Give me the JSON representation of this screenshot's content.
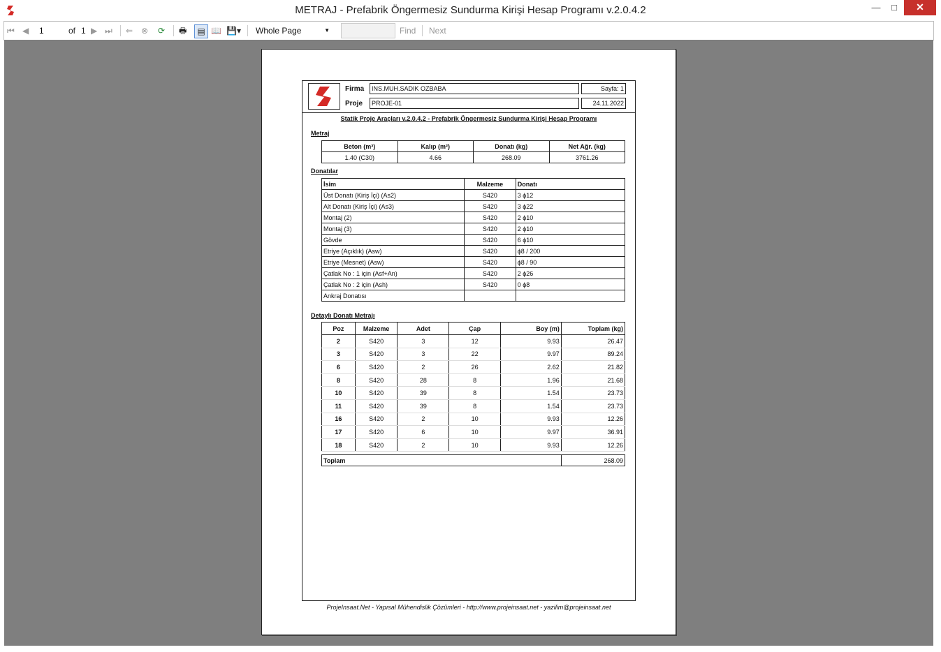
{
  "window": {
    "title": "METRAJ - Prefabrik Öngermesiz Sundurma Kirişi Hesap Programı v.2.0.4.2"
  },
  "toolbar": {
    "page_input": "1",
    "of_label": "of",
    "total_pages": "1",
    "zoom_selected": "Whole Page",
    "find_label": "Find",
    "next_label": "Next",
    "search_value": ""
  },
  "report": {
    "firma_label": "Firma",
    "firma_value": "INS.MUH.SADIK OZBABA",
    "proje_label": "Proje",
    "proje_value": "PROJE-01",
    "sayfa": "Sayfa: 1",
    "date": "24.11.2022",
    "subtitle": "Statik Proje Araçları v.2.0.4.2 - Prefabrik Öngermesiz Sundurma Kirişi Hesap Programı",
    "metraj_title": "Metraj",
    "metraj_headers": [
      "Beton (m³)",
      "Kalıp (m²)",
      "Donatı (kg)",
      "Net Ağr. (kg)"
    ],
    "metraj_values": [
      "1.40 (C30)",
      "4.66",
      "268.09",
      "3761.26"
    ],
    "donatilar_title": "Donatılar",
    "donatilar_headers": [
      "İsim",
      "Malzeme",
      "Donatı"
    ],
    "donatilar_rows": [
      [
        "Üst Donatı (Kiriş İçi) (As2)",
        "S420",
        "3 ϕ12"
      ],
      [
        "Alt Donatı (Kiriş İçi) (As3)",
        "S420",
        "3 ϕ22"
      ],
      [
        "Montaj (2)",
        "S420",
        "2 ϕ10"
      ],
      [
        "Montaj (3)",
        "S420",
        "2 ϕ10"
      ],
      [
        "Gövde",
        "S420",
        "6 ϕ10"
      ],
      [
        "Etriye (Açıklık) (Asw)",
        "S420",
        "ϕ8 / 200"
      ],
      [
        "Etriye (Mesnet) (Asw)",
        "S420",
        "ϕ8 / 90"
      ],
      [
        "Çatlak No : 1 için (Asf+An)",
        "S420",
        "2 ϕ26"
      ],
      [
        "Çatlak No : 2 için (Ash)",
        "S420",
        "0 ϕ8"
      ],
      [
        "Ankraj Donatısı",
        "",
        ""
      ]
    ],
    "detay_title": "Detaylı Donatı Metrajı",
    "detay_headers": [
      "Poz",
      "Malzeme",
      "Adet",
      "Çap",
      "Boy (m)",
      "Toplam (kg)"
    ],
    "detay_rows": [
      [
        "2",
        "S420",
        "3",
        "12",
        "9.93",
        "26.47"
      ],
      [
        "3",
        "S420",
        "3",
        "22",
        "9.97",
        "89.24"
      ],
      [
        "6",
        "S420",
        "2",
        "26",
        "2.62",
        "21.82"
      ],
      [
        "8",
        "S420",
        "28",
        "8",
        "1.96",
        "21.68"
      ],
      [
        "10",
        "S420",
        "39",
        "8",
        "1.54",
        "23.73"
      ],
      [
        "11",
        "S420",
        "39",
        "8",
        "1.54",
        "23.73"
      ],
      [
        "16",
        "S420",
        "2",
        "10",
        "9.93",
        "12.26"
      ],
      [
        "17",
        "S420",
        "6",
        "10",
        "9.97",
        "36.91"
      ],
      [
        "18",
        "S420",
        "2",
        "10",
        "9.93",
        "12.26"
      ]
    ],
    "toplam_label": "Toplam",
    "toplam_value": "268.09",
    "footer": "ProjeInsaat.Net - Yapısal Mühendislik Çözümleri - http://www.projeinsaat.net - yazilim@projeinsaat.net"
  },
  "colors": {
    "viewer_bg": "#7f7f7f",
    "logo_red": "#d42a26",
    "close_red": "#c7302b"
  }
}
